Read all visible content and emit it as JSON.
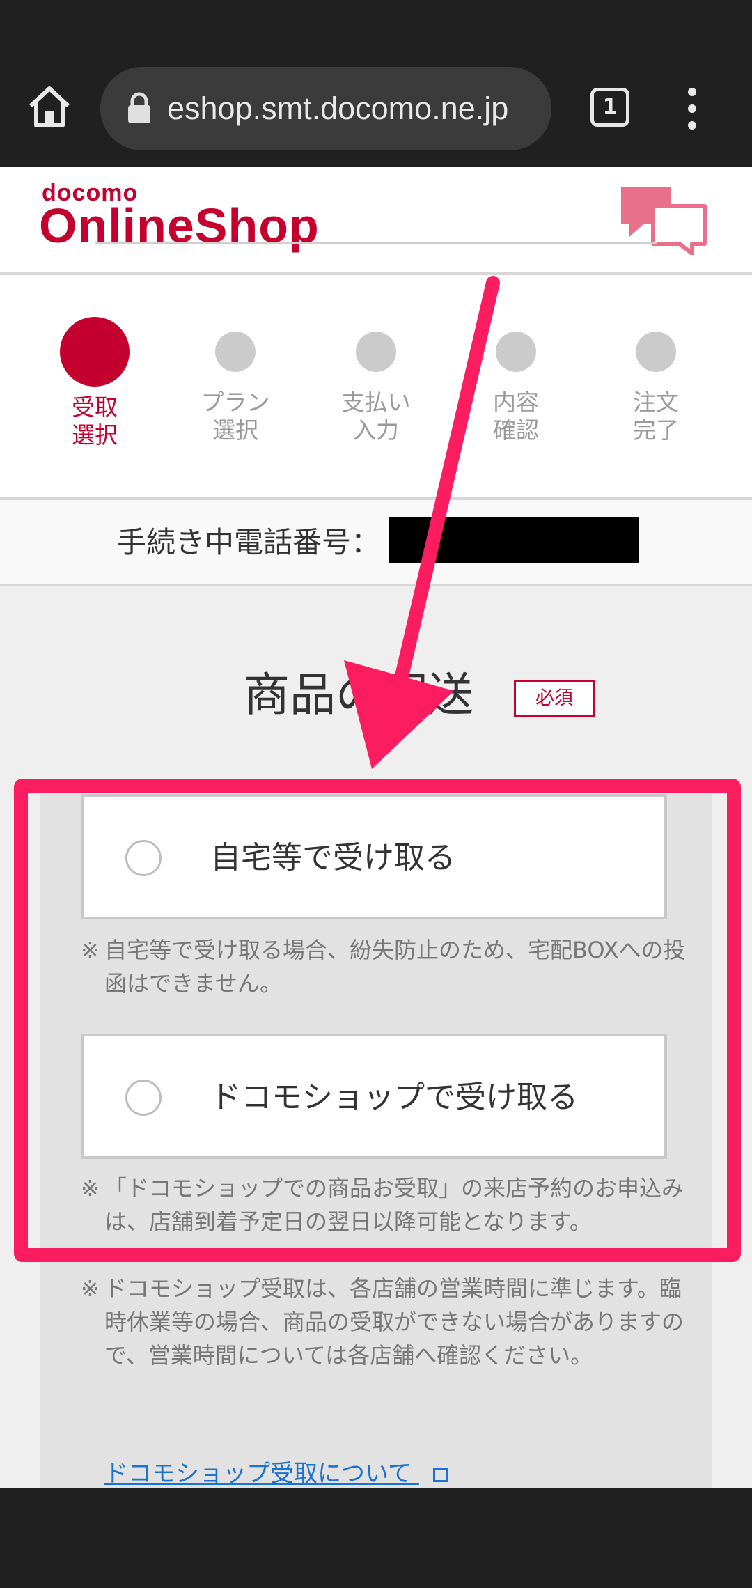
{
  "browser": {
    "url": "eshop.smt.docomo.ne.jp",
    "tab_count": "1"
  },
  "header": {
    "logo_top": "docomo",
    "logo_main": "OnlineShop"
  },
  "steps": [
    {
      "label": "受取\n選択",
      "active": true
    },
    {
      "label": "プラン\n選択",
      "active": false
    },
    {
      "label": "支払い\n入力",
      "active": false
    },
    {
      "label": "内容\n確認",
      "active": false
    },
    {
      "label": "注文\n完了",
      "active": false
    }
  ],
  "phone": {
    "label": "手続き中電話番号："
  },
  "section": {
    "title": "商品の配送",
    "required": "必須"
  },
  "options": {
    "home": "自宅等で受け取る",
    "shop": "ドコモショップで受け取る"
  },
  "notes": {
    "home_note": "自宅等で受け取る場合、紛失防止のため、宅配BOXへの投函はできません。",
    "shop_note1": "「ドコモショップでの商品お受取」の来店予約のお申込みは、店舗到着予定日の翌日以降可能となります。",
    "shop_note2": "ドコモショップ受取は、各店舗の営業時間に準じます。臨時休業等の場合、商品の受取ができない場合がありますので、営業時間については各店舗へ確認ください。",
    "mark": "※"
  },
  "link": {
    "text": "ドコモショップ受取について"
  },
  "colors": {
    "brand": "#c4002e",
    "annotation": "#fc1c60",
    "link": "#1a73d1"
  }
}
